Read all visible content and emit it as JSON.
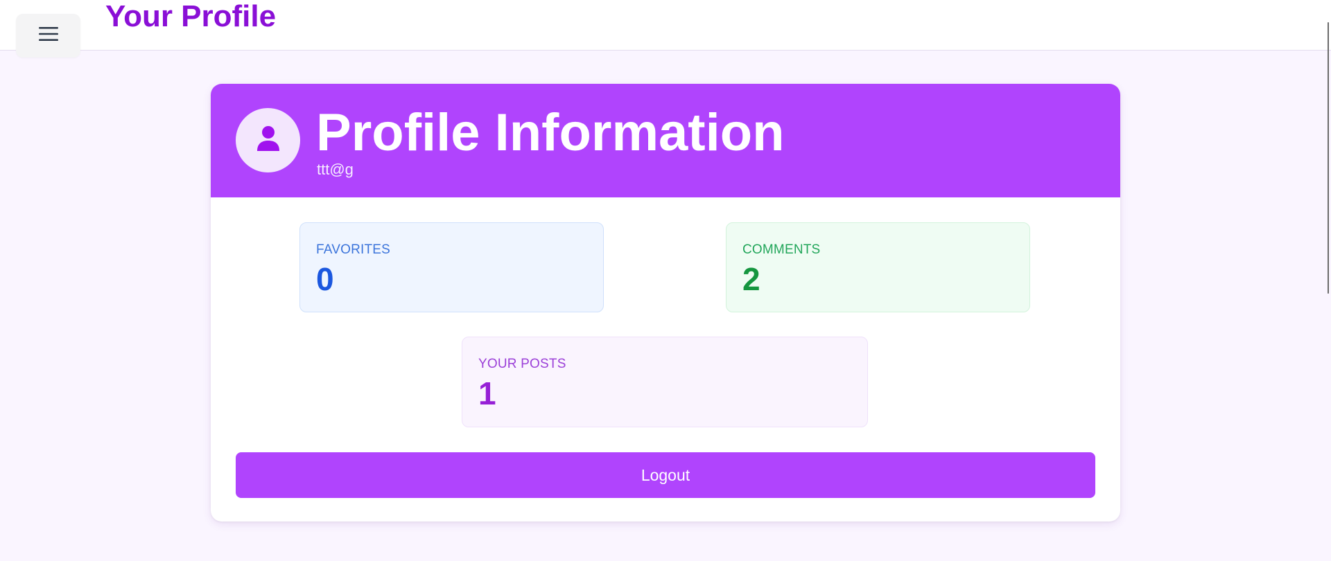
{
  "header": {
    "menu_icon": "hamburger-menu-icon",
    "title": "Your Profile"
  },
  "profile": {
    "avatar_icon": "user-icon",
    "title": "Profile Information",
    "email": "ttt@g"
  },
  "stats": {
    "favorites": {
      "label": "FAVORITES",
      "value": "0",
      "color": "#1b57df"
    },
    "comments": {
      "label": "COMMENTS",
      "value": "2",
      "color": "#15963f"
    },
    "posts": {
      "label": "YOUR POSTS",
      "value": "1",
      "color": "#9620d6"
    }
  },
  "actions": {
    "logout_label": "Logout"
  },
  "colors": {
    "accent": "#b044fd",
    "title": "#8a0fd6",
    "page_background": "#faf5ff"
  }
}
